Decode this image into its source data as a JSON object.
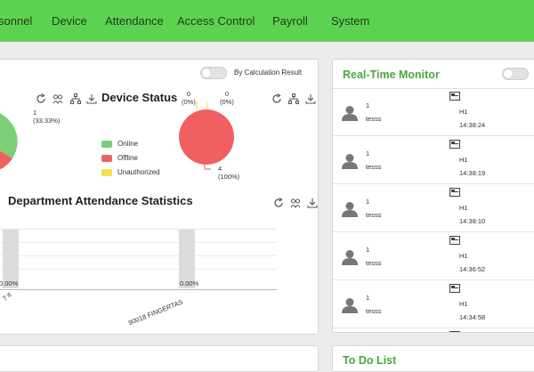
{
  "nav": {
    "items": [
      "sonnel",
      "Device",
      "Attendance",
      "Access Control",
      "Payroll",
      "System"
    ]
  },
  "dashboard": {
    "by_calculation_label": "By Calculation Result",
    "device_status": {
      "title": "Device Status",
      "left_pie_label": "1\n(33.33%)",
      "top_labels": [
        "0\n(0%)",
        "0\n(0%)"
      ],
      "offline_label": "4\n(100%)",
      "legend": [
        {
          "label": "Online",
          "color": "#7ccf76"
        },
        {
          "label": "Offline",
          "color": "#f06060"
        },
        {
          "label": "Unauthorized",
          "color": "#f3e04a"
        }
      ]
    },
    "department_stats": {
      "title": "Department Attendance Statistics",
      "bar_labels": [
        "0.00%",
        "0.00%"
      ],
      "x_labels": [
        "7 it",
        "90018 FINGERTAS"
      ]
    }
  },
  "chart_data": [
    {
      "type": "pie",
      "title": "Device Status",
      "categories": [
        "Online",
        "Offline",
        "Unauthorized"
      ],
      "values": [
        0,
        4,
        0
      ],
      "percent_labels": [
        "(0%)",
        "(100%)",
        "(0%)"
      ],
      "colors": [
        "#7ccf76",
        "#f06060",
        "#f3e04a"
      ],
      "legend_position": "left"
    },
    {
      "type": "bar",
      "title": "Department Attendance Statistics",
      "categories": [
        "7 it",
        "90018 FINGERTAS"
      ],
      "values": [
        0.0,
        0.0
      ],
      "value_labels": [
        "0.00%",
        "0.00%"
      ]
    }
  ],
  "realtime": {
    "title": "Real-Time Monitor",
    "rows": [
      {
        "num": "1",
        "name": "tesss",
        "device": "H1",
        "time": "14:38:24"
      },
      {
        "num": "1",
        "name": "tesss",
        "device": "H1",
        "time": "14:38:19"
      },
      {
        "num": "1",
        "name": "tesss",
        "device": "H1",
        "time": "14:38:10"
      },
      {
        "num": "1",
        "name": "tesss",
        "device": "H1",
        "time": "14:36:52"
      },
      {
        "num": "1",
        "name": "tesss",
        "device": "H1",
        "time": "14:34:58"
      }
    ]
  },
  "todo": {
    "title": "To Do List"
  }
}
